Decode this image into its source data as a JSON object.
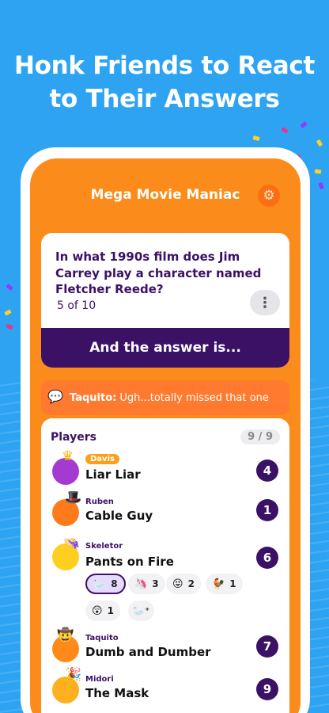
{
  "headline": [
    "Honk Friends to React",
    "to Their Answers"
  ],
  "app": {
    "title": "Mega Movie Maniac",
    "settings_icon": "gear-icon"
  },
  "question": {
    "text": "In what 1990s film does Jim Carrey play a character named Fletcher Reede?",
    "progress": "5 of 10",
    "more_icon": "⋮",
    "answer_button": "And the answer is..."
  },
  "chat": {
    "author": "Taquito:",
    "message": "Ugh...totally missed that one"
  },
  "players": {
    "title": "Players",
    "count": "9 / 9",
    "list": [
      {
        "name": "Davis",
        "answer": "Liar Liar",
        "score": "4",
        "highlight": true
      },
      {
        "name": "Ruben",
        "answer": "Cable Guy",
        "score": "1"
      },
      {
        "name": "Skeletor",
        "answer": "Pants on Fire",
        "score": "6",
        "reactions": [
          {
            "icon": "🦢",
            "count": "8"
          },
          {
            "icon": "🦄",
            "count": "3"
          },
          {
            "icon": "😝",
            "count": "2"
          },
          {
            "icon": "🐓",
            "count": "1"
          },
          {
            "icon": "😲",
            "count": "1"
          }
        ]
      },
      {
        "name": "Taquito",
        "answer": "Dumb and Dumber",
        "score": "7"
      },
      {
        "name": "Midori",
        "answer": "The Mask",
        "score": "9"
      }
    ]
  },
  "colors": {
    "background": "#2ea3f2",
    "orange": "#fb8c1b",
    "purple": "#3b1166"
  }
}
